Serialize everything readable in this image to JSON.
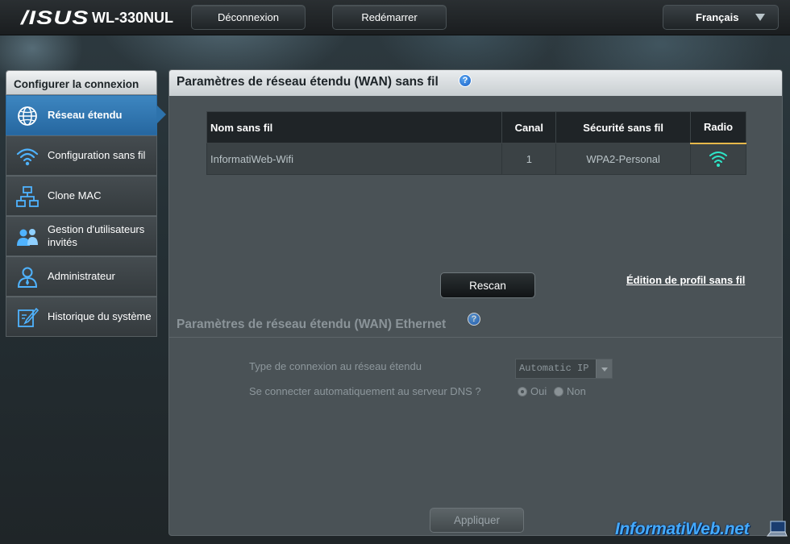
{
  "header": {
    "brand": "/ISUS",
    "model": "WL-330NUL",
    "logout_label": "Déconnexion",
    "reboot_label": "Redémarrer",
    "language": "Français"
  },
  "sidebar": {
    "title": "Configurer la connexion",
    "items": [
      {
        "label": "Réseau étendu",
        "icon": "globe-icon",
        "active": true
      },
      {
        "label": "Configuration sans fil",
        "icon": "wifi-icon",
        "active": false
      },
      {
        "label": "Clone MAC",
        "icon": "network-icon",
        "active": false
      },
      {
        "label": "Gestion d'utilisateurs invités",
        "icon": "users-icon",
        "active": false
      },
      {
        "label": "Administrateur",
        "icon": "admin-icon",
        "active": false
      },
      {
        "label": "Historique du système",
        "icon": "log-icon",
        "active": false
      }
    ]
  },
  "wan_wireless": {
    "title": "Paramètres de réseau étendu (WAN) sans fil",
    "help": "?",
    "table": {
      "headers": [
        "Nom sans fil",
        "Canal",
        "Sécurité sans fil",
        "Radio"
      ],
      "rows": [
        {
          "ssid": "InformatiWeb-Wifi",
          "channel": "1",
          "security": "WPA2-Personal",
          "radio_icon": "wifi-signal-icon"
        }
      ]
    },
    "rescan_label": "Rescan",
    "edit_profile_label": "Édition de profil sans fil"
  },
  "wan_ethernet": {
    "title": "Paramètres de réseau étendu (WAN) Ethernet",
    "help": "?",
    "connection_type_label": "Type de connexion au réseau étendu",
    "connection_type_value": "Automatic IP",
    "dns_auto_label": "Se connecter automatiquement au serveur DNS ?",
    "dns_yes": "Oui",
    "dns_no": "Non",
    "dns_selected": "Oui"
  },
  "apply_label": "Appliquer",
  "watermark": "InformatiWeb.net",
  "colors": {
    "accent": "#2d72ab",
    "radio_icon": "#2ee6c8",
    "watermark": "#44aaff",
    "radio_header_underline": "#e7b84b"
  }
}
